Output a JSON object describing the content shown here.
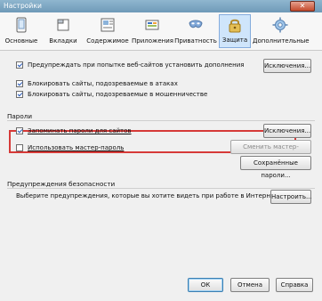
{
  "window": {
    "title": "Настройки",
    "close_symbol": "✕"
  },
  "tabs": [
    {
      "label": "Основные",
      "icon": "general-settings-icon"
    },
    {
      "label": "Вкладки",
      "icon": "tabs-icon"
    },
    {
      "label": "Содержимое",
      "icon": "content-icon"
    },
    {
      "label": "Приложения",
      "icon": "applications-icon"
    },
    {
      "label": "Приватность",
      "icon": "privacy-mask-icon"
    },
    {
      "label": "Защита",
      "icon": "lock-icon",
      "active": true
    },
    {
      "label": "Дополнительные",
      "icon": "advanced-gear-icon"
    }
  ],
  "security": {
    "warn_addons_label": "Предупреждать при попытке веб-сайтов установить дополнения",
    "exceptions_button": "Исключения...",
    "block_attack_label": "Блокировать сайты, подозреваемые в атаках",
    "block_fraud_label": "Блокировать сайты, подозреваемые в мошенничестве"
  },
  "passwords": {
    "section_title": "Пароли",
    "remember_label": "Запоминать пароли для сайтов",
    "master_password_label": "Использовать мастер-пароль",
    "exceptions_button": "Исключения...",
    "change_master_button": "Сменить мастер-пароль...",
    "saved_passwords_button": "Сохранённые пароли..."
  },
  "warnings": {
    "section_title": "Предупреждения безопасности",
    "description": "Выберите предупреждения, которые вы хотите видеть при работе в Интернете",
    "settings_button": "Настроить..."
  },
  "footer": {
    "ok_button": "ОК",
    "cancel_button": "Отмена",
    "help_button": "Справка"
  },
  "colors": {
    "highlight": "#d63a38",
    "active_tab_bg": "#cfe5fb"
  }
}
